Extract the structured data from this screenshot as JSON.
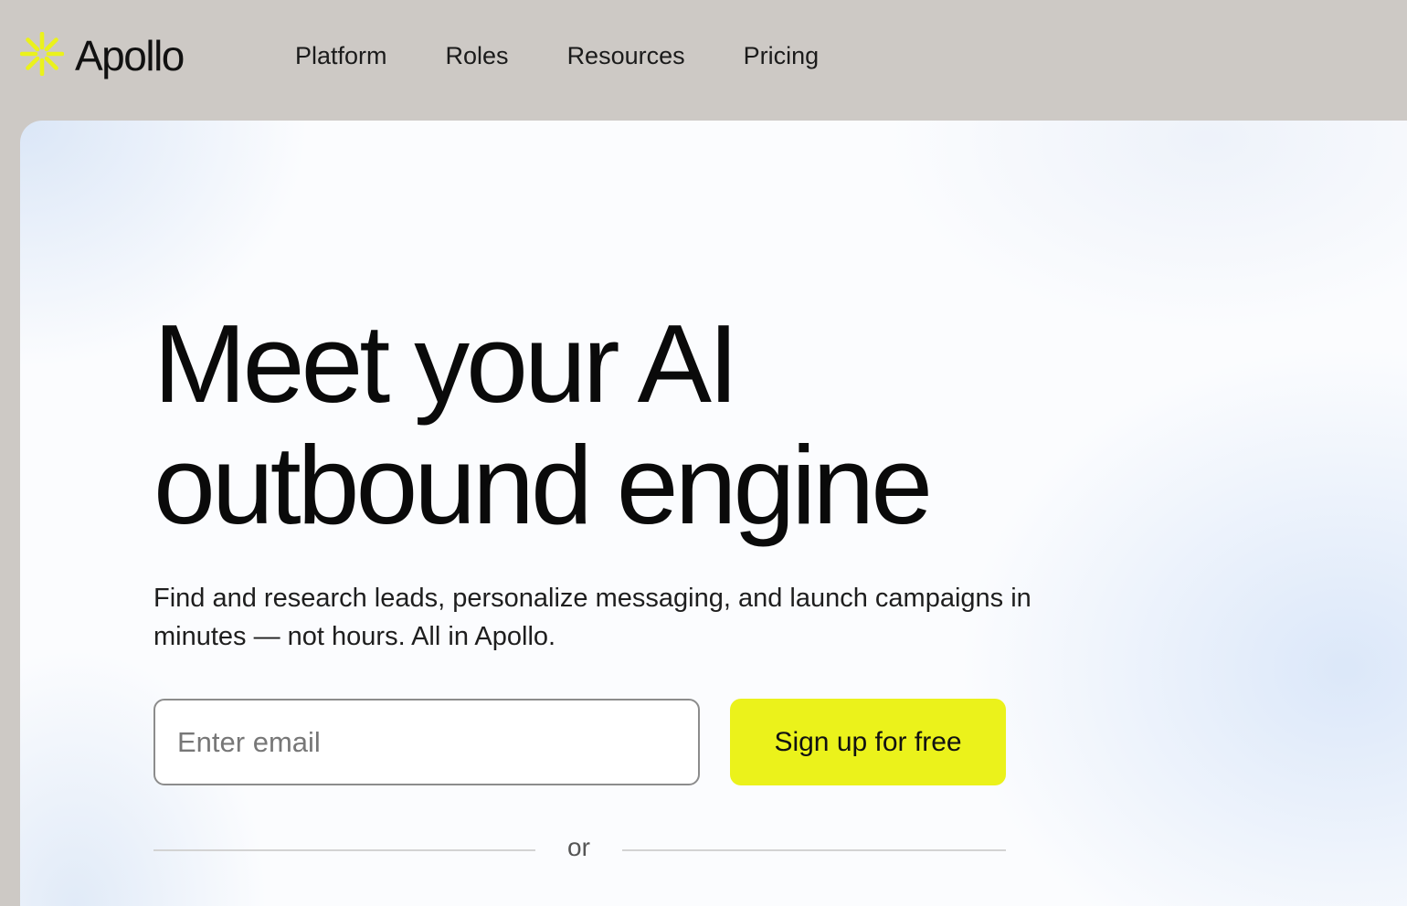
{
  "brand": {
    "name": "Apollo",
    "accent_color": "#ebf21b",
    "icon": "sunburst-logo-icon"
  },
  "nav": {
    "items": [
      {
        "label": "Platform"
      },
      {
        "label": "Roles"
      },
      {
        "label": "Resources"
      },
      {
        "label": "Pricing"
      }
    ]
  },
  "hero": {
    "headline_line1": "Meet your AI",
    "headline_line2": "outbound engine",
    "subhead": "Find and research leads, personalize messaging, and launch campaigns in minutes — not hours. All in Apollo.",
    "email_placeholder": "Enter email",
    "email_value": "",
    "signup_label": "Sign up for free",
    "divider_text": "or"
  }
}
